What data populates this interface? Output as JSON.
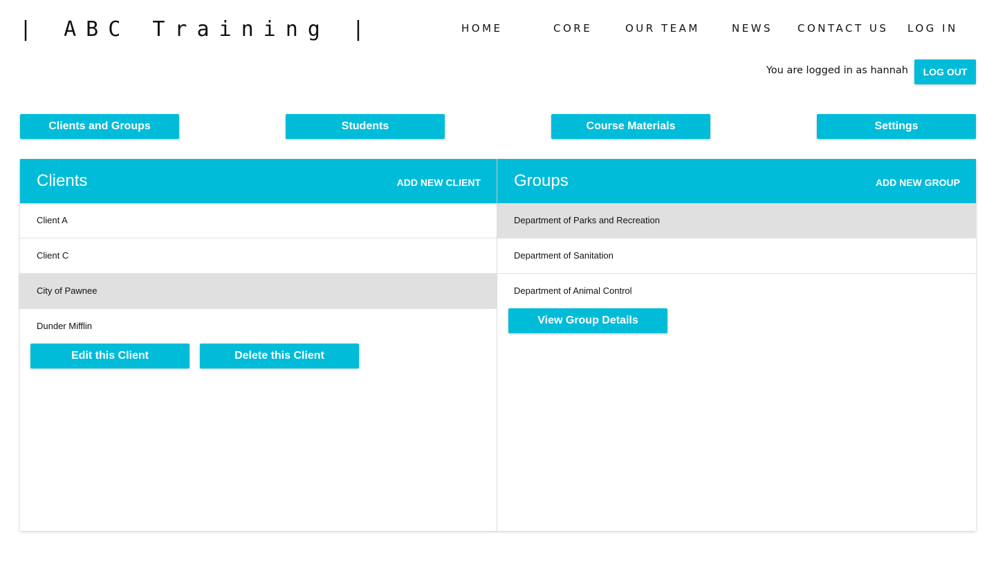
{
  "brand": {
    "logo": "| ABC Training |"
  },
  "nav": {
    "home": "HOME",
    "core": "CORE",
    "our_team": "OUR TEAM",
    "news": "NEWS",
    "contact_us": "CONTACT US",
    "log_in": "LOG IN"
  },
  "session": {
    "status": "You are logged in as hannah",
    "logout_label": "LOG OUT"
  },
  "tabs": {
    "clients_groups": "Clients and Groups",
    "students": "Students",
    "course_materials": "Course Materials",
    "settings": "Settings"
  },
  "clients": {
    "title": "Clients",
    "add_label": "ADD NEW CLIENT",
    "items": [
      "Client A",
      "Client C",
      "City of Pawnee",
      "Dunder Mifflin"
    ],
    "selected": "City of Pawnee",
    "edit_label": "Edit this Client",
    "delete_label": "Delete this Client"
  },
  "groups": {
    "title": "Groups",
    "add_label": "ADD NEW GROUP",
    "items": [
      "Department of Parks and Recreation",
      "Department of Sanitation",
      "Department of Animal Control"
    ],
    "selected": "Department of Parks and Recreation",
    "view_label": "View Group Details"
  },
  "colors": {
    "accent": "#00bcd9",
    "selected_row": "#e0e0e0",
    "text": "#111111"
  }
}
